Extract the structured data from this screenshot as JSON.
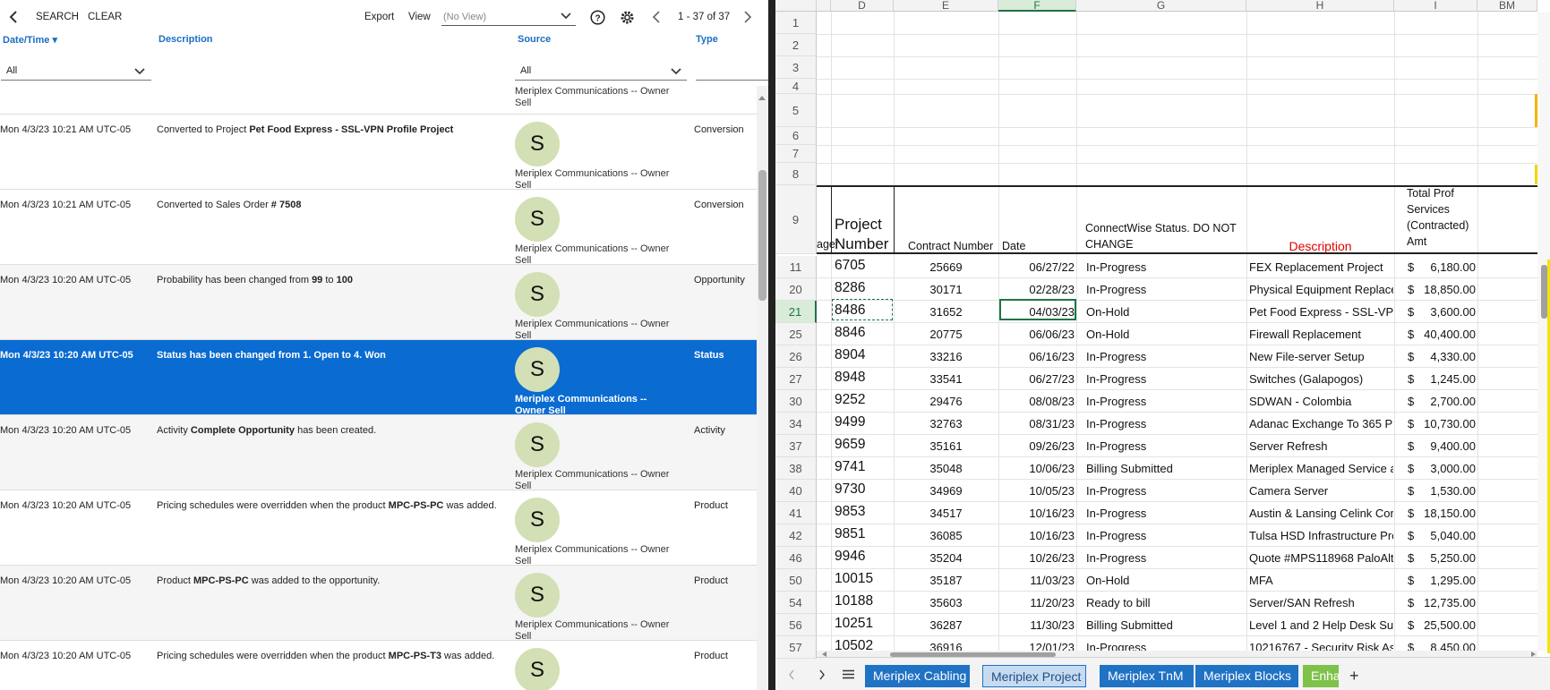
{
  "left": {
    "toolbar": {
      "search": "SEARCH",
      "clear": "CLEAR",
      "export": "Export",
      "view": "View",
      "view_value": "(No View)",
      "pager": "1 - 37 of 37"
    },
    "columns": {
      "datetime": "Date/Time",
      "description": "Description",
      "source": "Source",
      "type": "Type"
    },
    "filters": {
      "datetime": "All",
      "source": "All"
    },
    "top_stub": "Meriplex Communications -- Owner Sell",
    "rows": [
      {
        "datetime": "Mon 4/3/23 10:21 AM UTC-05",
        "desc_pre": "Converted to Project ",
        "desc_bold": "Pet Food Express - SSL-VPN Profile Project",
        "desc_post": "",
        "avatar": "S",
        "owner": "Meriplex Communications -- Owner Sell",
        "type": "Conversion"
      },
      {
        "datetime": "Mon 4/3/23 10:21 AM UTC-05",
        "desc_pre": "Converted to Sales Order ",
        "desc_bold": "# 7508",
        "desc_post": "",
        "avatar": "S",
        "owner": "Meriplex Communications -- Owner Sell",
        "type": "Conversion"
      },
      {
        "datetime": "Mon 4/3/23 10:20 AM UTC-05",
        "desc_pre": "Probability has been changed from ",
        "desc_bold": "99",
        "desc_mid": " to ",
        "desc_bold2": "100",
        "avatar": "S",
        "owner": "Meriplex Communications -- Owner Sell",
        "type": "Opportunity"
      },
      {
        "datetime": "Mon 4/3/23 10:20 AM UTC-05",
        "desc_pre": "Status has been changed from ",
        "desc_bold": "1. Open",
        "desc_mid": " to ",
        "desc_bold2": "4. Won",
        "avatar": "S",
        "owner": "Meriplex Communications -- Owner Sell",
        "type": "Status"
      },
      {
        "datetime": "Mon 4/3/23 10:20 AM UTC-05",
        "desc_pre": "Activity ",
        "desc_bold": "Complete Opportunity",
        "desc_post": " has been created.",
        "avatar": "S",
        "owner": "Meriplex Communications -- Owner Sell",
        "type": "Activity"
      },
      {
        "datetime": "Mon 4/3/23 10:20 AM UTC-05",
        "desc_pre": "Pricing schedules were overridden when the product ",
        "desc_bold": "MPC-PS-PC",
        "desc_post": " was added.",
        "avatar": "S",
        "owner": "Meriplex Communications -- Owner Sell",
        "type": "Product"
      },
      {
        "datetime": "Mon 4/3/23 10:20 AM UTC-05",
        "desc_pre": "Product ",
        "desc_bold": "MPC-PS-PC",
        "desc_post": " was added to the opportunity.",
        "avatar": "S",
        "owner": "Meriplex Communications -- Owner Sell",
        "type": "Product"
      },
      {
        "datetime": "Mon 4/3/23 10:20 AM UTC-05",
        "desc_pre": "Pricing schedules were overridden when the product ",
        "desc_bold": "MPC-PS-T3",
        "desc_post": " was added.",
        "avatar": "S",
        "owner": "",
        "type": "Product"
      }
    ]
  },
  "sheet": {
    "col_headers": [
      "D",
      "E",
      "F",
      "G",
      "H",
      "I",
      "BM"
    ],
    "blank_rows": [
      "1",
      "2",
      "3",
      "4",
      "5",
      "6",
      "7",
      "8"
    ],
    "header_row": {
      "row": "9",
      "manager_stub": "ager",
      "project_number": "Project Number",
      "contract_number": "Contract Number",
      "date": "Date",
      "status": "ConnectWise Status. DO NOT CHANGE",
      "description": "Description",
      "total": "Total Prof Services (Contracted) Amt"
    },
    "rows": [
      {
        "row": "11",
        "pn": "6705",
        "contract": "25669",
        "date": "06/27/22",
        "status": "In-Progress",
        "desc": "FEX Replacement Project",
        "cur": "$",
        "amt": "6,180.00"
      },
      {
        "row": "20",
        "pn": "8286",
        "contract": "30171",
        "date": "02/28/23",
        "status": "In-Progress",
        "desc": "Physical Equipment Replacem",
        "cur": "$",
        "amt": "18,850.00"
      },
      {
        "row": "21",
        "pn": "8486",
        "contract": "31652",
        "date": "04/03/23",
        "status": "On-Hold",
        "desc": "Pet Food Express - SSL-VPN",
        "cur": "$",
        "amt": "3,600.00"
      },
      {
        "row": "25",
        "pn": "8846",
        "contract": "20775",
        "date": "06/06/23",
        "status": "On-Hold",
        "desc": "Firewall Replacement",
        "cur": "$",
        "amt": "40,400.00"
      },
      {
        "row": "26",
        "pn": "8904",
        "contract": "33216",
        "date": "06/16/23",
        "status": "In-Progress",
        "desc": "New File-server Setup",
        "cur": "$",
        "amt": "4,330.00"
      },
      {
        "row": "27",
        "pn": "8948",
        "contract": "33541",
        "date": "06/27/23",
        "status": "In-Progress",
        "desc": "Switches (Galapogos)",
        "cur": "$",
        "amt": "1,245.00"
      },
      {
        "row": "30",
        "pn": "9252",
        "contract": "29476",
        "date": "08/08/23",
        "status": "In-Progress",
        "desc": "SDWAN - Colombia",
        "cur": "$",
        "amt": "2,700.00"
      },
      {
        "row": "34",
        "pn": "9499",
        "contract": "32763",
        "date": "08/31/23",
        "status": "In-Progress",
        "desc": "Adanac  Exchange To 365 Pr",
        "cur": "$",
        "amt": "10,730.00"
      },
      {
        "row": "37",
        "pn": "9659",
        "contract": "35161",
        "date": "09/26/23",
        "status": "In-Progress",
        "desc": "Server Refresh",
        "cur": "$",
        "amt": "9,400.00"
      },
      {
        "row": "38",
        "pn": "9741",
        "contract": "35048",
        "date": "10/06/23",
        "status": "Billing Submitted",
        "desc": "Meriplex Managed Service a",
        "cur": "$",
        "amt": "3,000.00"
      },
      {
        "row": "40",
        "pn": "9730",
        "contract": "34969",
        "date": "10/05/23",
        "status": "In-Progress",
        "desc": "Camera Server",
        "cur": "$",
        "amt": "1,530.00"
      },
      {
        "row": "41",
        "pn": "9853",
        "contract": "34517",
        "date": "10/16/23",
        "status": "In-Progress",
        "desc": "Austin & Lansing Celink Cor",
        "cur": "$",
        "amt": "18,150.00"
      },
      {
        "row": "42",
        "pn": "9851",
        "contract": "36085",
        "date": "10/16/23",
        "status": "In-Progress",
        "desc": "Tulsa HSD Infrastructure Pro",
        "cur": "$",
        "amt": "5,040.00"
      },
      {
        "row": "46",
        "pn": "9946",
        "contract": "35204",
        "date": "10/26/23",
        "status": "In-Progress",
        "desc": "Quote #MPS118968 PaloAlt",
        "cur": "$",
        "amt": "5,250.00"
      },
      {
        "row": "50",
        "pn": "10015",
        "contract": "35187",
        "date": "11/03/23",
        "status": "On-Hold",
        "desc": "MFA",
        "cur": "$",
        "amt": "1,295.00"
      },
      {
        "row": "54",
        "pn": "10188",
        "contract": "35603",
        "date": "11/20/23",
        "status": "Ready to bill",
        "desc": "Server/SAN Refresh",
        "cur": "$",
        "amt": "12,735.00"
      },
      {
        "row": "56",
        "pn": "10251",
        "contract": "36287",
        "date": "11/30/23",
        "status": "Billing Submitted",
        "desc": "Level 1 and 2 Help Desk Sup",
        "cur": "$",
        "amt": "25,500.00"
      },
      {
        "row": "57",
        "pn": "10502",
        "contract": "36916",
        "date": "12/01/23",
        "status": "In-Progress",
        "desc": "10216767 - Security Risk As",
        "cur": "$",
        "amt": "8,450.00"
      }
    ],
    "tabs": [
      "Meriplex Cabling",
      "Meriplex Project",
      "Meriplex TnM",
      "Meriplex Blocks",
      "Enha"
    ],
    "active_tab": "Meriplex Project",
    "colors": {
      "description_header": "#e00000",
      "tab_blue": "#1f72c4",
      "tab_green": "#7ec24a",
      "select_green": "#217346"
    }
  }
}
